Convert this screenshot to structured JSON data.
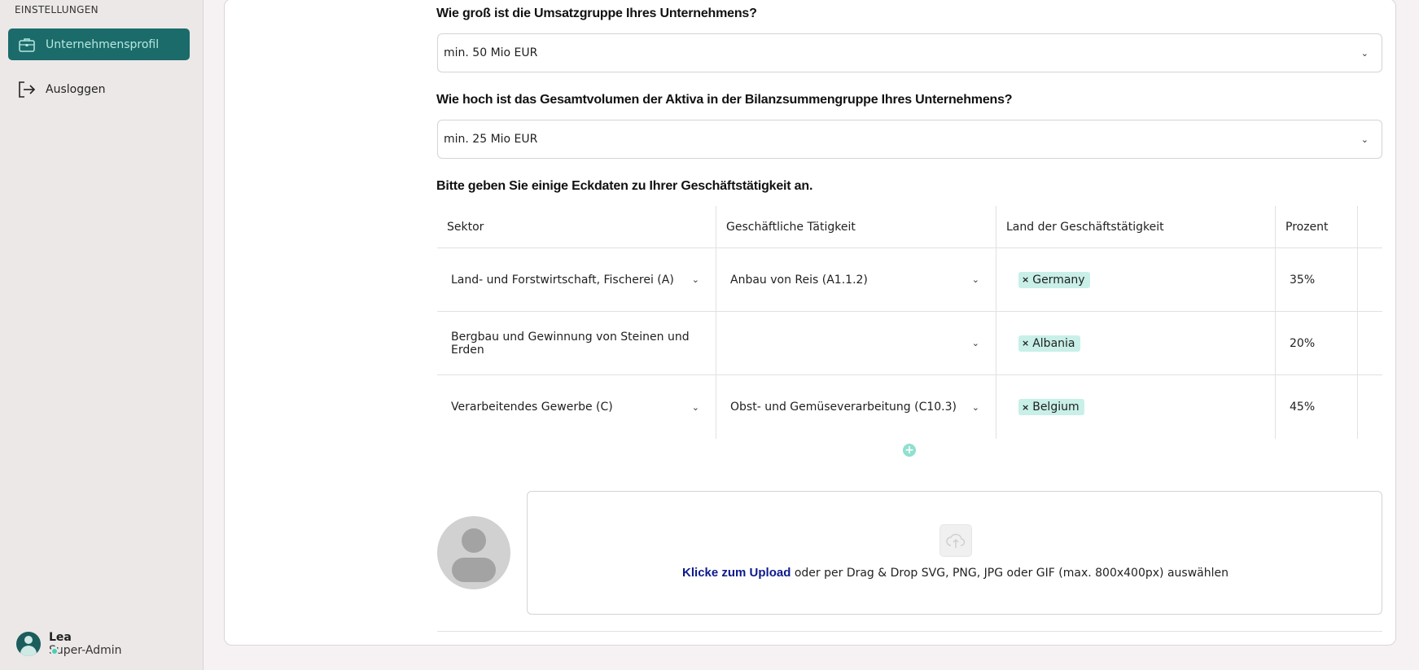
{
  "sidebar": {
    "section_label": "EINSTELLUNGEN",
    "items": [
      {
        "label": "Unternehmensprofil",
        "icon": "briefcase-icon"
      },
      {
        "label": "Ausloggen",
        "icon": "logout-icon"
      }
    ],
    "user": {
      "name": "Lea",
      "role": "Super-Admin"
    }
  },
  "form": {
    "q_revenue": "Wie groß ist die Umsatzgruppe Ihres Unternehmens?",
    "revenue_value": "min. 50 Mio EUR",
    "q_assets": "Wie hoch ist das Gesamtvolumen der Aktiva in der Bilanzsummengruppe Ihres Unternehmens?",
    "assets_value": "min. 25 Mio EUR",
    "q_business": "Bitte geben Sie einige Eckdaten zu Ihrer Geschäftstätigkeit an."
  },
  "table": {
    "headers": [
      "Sektor",
      "Geschäftliche Tätigkeit",
      "Land der Geschäftstätigkeit",
      "Prozent"
    ],
    "rows": [
      {
        "sector": "Land- und Forstwirtschaft, Fischerei (A)",
        "activity": "Anbau von Reis (A1.1.2)",
        "country": "Germany",
        "percent": "35%"
      },
      {
        "sector": "Bergbau und Gewinnung von Steinen und Erden",
        "activity": "",
        "country": "Albania",
        "percent": "20%"
      },
      {
        "sector": "Verarbeitendes Gewerbe (C)",
        "activity": "Obst- und Gemüseverarbeitung (C10.3)",
        "country": "Belgium",
        "percent": "45%"
      }
    ]
  },
  "upload": {
    "link_text": "Klicke zum Upload",
    "rest_text": " oder per Drag & Drop SVG, PNG, JPG oder GIF (max. 800x400px) auswählen"
  },
  "colors": {
    "accent": "#1b6b6b",
    "tag_bg": "#c9f0e8",
    "link": "#0c1a8c"
  }
}
